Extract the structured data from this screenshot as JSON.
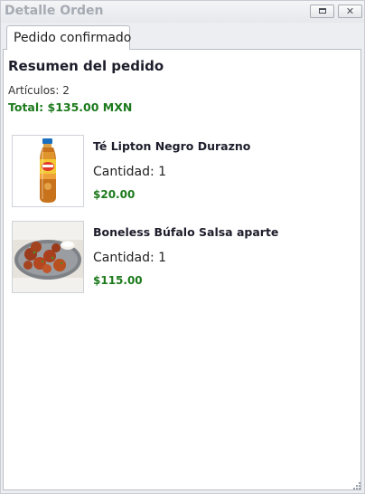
{
  "window": {
    "title": "Detalle Orden",
    "controls": [
      "maximize-icon",
      "close-icon"
    ],
    "close_glyph": "✕"
  },
  "tabs": [
    {
      "label": "Pedido confirmado",
      "active": true
    }
  ],
  "summary": {
    "heading": "Resumen del pedido",
    "items_label": "Artículos:",
    "items_count": "2",
    "total": "Total: $135.00 MXN"
  },
  "items": [
    {
      "name": "Té Lipton Negro Durazno",
      "qty_label": "Cantidad:",
      "qty": "1",
      "price": "$20.00",
      "image_icon": "iced-tea-bottle-image"
    },
    {
      "name": "Boneless Búfalo Salsa aparte",
      "qty_label": "Cantidad:",
      "qty": "1",
      "price": "$115.00",
      "image_icon": "boneless-wings-plate-image"
    }
  ],
  "colors": {
    "price_green": "#1c7a1c",
    "title_gray": "#a6abb3",
    "heading_dark": "#1d1d2b"
  }
}
